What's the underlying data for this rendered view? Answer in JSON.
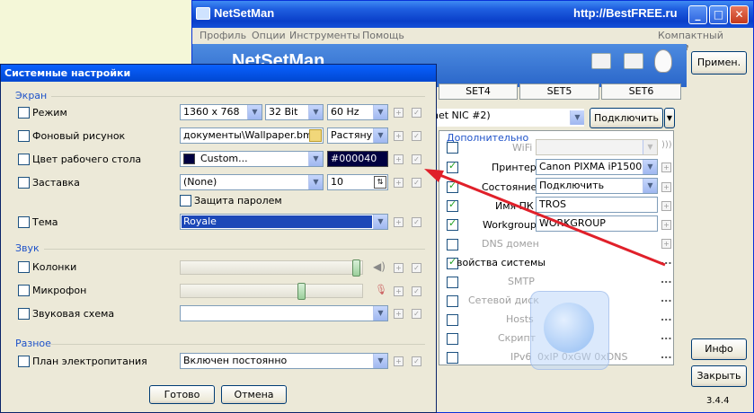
{
  "bg_window": {
    "title": "NetSetMan",
    "watermark": "http://BestFREE.ru",
    "menu": [
      "Профиль",
      "Опции",
      "Инструменты",
      "Помощь"
    ],
    "compact_mode": "Компактный режим",
    "header_title": "NetSetMan",
    "tabs": [
      "SET4",
      "SET5",
      "SET6"
    ],
    "nic_value": "net NIC #2)",
    "connect_label": "Подключить",
    "extra_group": "Дополнительно",
    "extra_rows": [
      {
        "label": "WiFi",
        "checked": false,
        "enabled": false,
        "value": ""
      },
      {
        "label": "Принтер",
        "checked": true,
        "enabled": true,
        "value": "Canon PIXMA iP1500"
      },
      {
        "label": "Состояние",
        "checked": true,
        "enabled": true,
        "value": "Подключить"
      },
      {
        "label": "Имя ПК",
        "checked": true,
        "enabled": true,
        "value": "TROS"
      },
      {
        "label": "Workgroup",
        "checked": true,
        "enabled": true,
        "value": "WORKGROUP"
      },
      {
        "label": "DNS домен",
        "checked": false,
        "enabled": false,
        "value": ""
      },
      {
        "label": "войства системы",
        "checked": true,
        "enabled": true,
        "value": ""
      },
      {
        "label": "SMTP",
        "checked": false,
        "enabled": false,
        "value": ""
      },
      {
        "label": "Сетевой диск",
        "checked": false,
        "enabled": false,
        "value": ""
      },
      {
        "label": "Hosts",
        "checked": false,
        "enabled": false,
        "value": ""
      },
      {
        "label": "Скрипт",
        "checked": false,
        "enabled": false,
        "value": ""
      },
      {
        "label": "IPv6",
        "checked": false,
        "enabled": false,
        "value": "0xIP 0xGW 0xDNS"
      }
    ],
    "buttons": {
      "apply": "Примен.",
      "info": "Инфо",
      "close": "Закрыть"
    },
    "version": "3.4.4"
  },
  "dialog": {
    "title": "Системные настройки",
    "groups": {
      "screen": "Экран",
      "sound": "Звук",
      "misc": "Разное"
    },
    "rows": {
      "mode": {
        "label": "Режим",
        "resolution": "1360 x 768",
        "bits": "32 Bit",
        "freq": "60 Hz"
      },
      "wallpaper": {
        "label": "Фоновый рисунок",
        "path": "документы\\Wallpaper.bmp",
        "style": "Растяну"
      },
      "desk_color": {
        "label": "Цвет рабочего стола",
        "value": "Custom...",
        "hex": "#000040"
      },
      "screensaver": {
        "label": "Заставка",
        "value": "(None)",
        "timeout": "10",
        "password_label": "Защита паролем"
      },
      "theme": {
        "label": "Тема",
        "value": "Royale"
      },
      "speakers": {
        "label": "Колонки",
        "level": 1.0
      },
      "microphone": {
        "label": "Микрофон",
        "level": 0.68
      },
      "sound_scheme": {
        "label": "Звуковая схема",
        "value": ""
      },
      "power_plan": {
        "label": "План электропитания",
        "value": "Включен постоянно"
      }
    },
    "ok_label": "Готово",
    "cancel_label": "Отмена"
  },
  "colors": {
    "titlebar": "#0a4fd8",
    "accent_arrow": "#e0202a",
    "selected_theme": "#1c48b8",
    "color_swatch": "#000040"
  }
}
